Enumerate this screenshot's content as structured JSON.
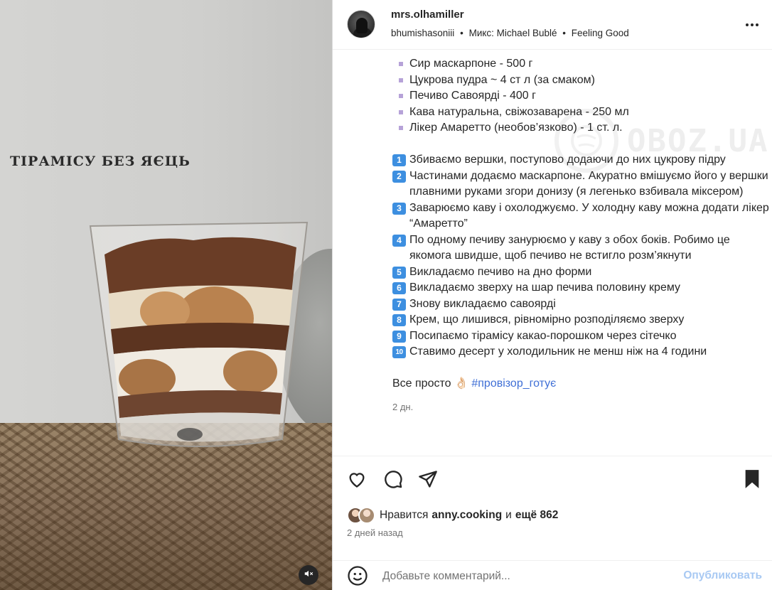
{
  "media": {
    "overlay_title": "ТІРАМІСУ БЕЗ ЯЄЦЬ",
    "mute_icon": "speaker-muted-icon"
  },
  "header": {
    "username": "mrs.olhamiller",
    "audio_author": "bhumishasoniii",
    "separator": "•",
    "audio_label": "Микс: Michael Bublé",
    "audio_track": "Feeling Good",
    "more_icon": "more-options-icon"
  },
  "caption": {
    "ingredients": [
      "Сир маскарпоне - 500 г",
      "Цукрова пудра ~ 4 ст л (за смаком)",
      "Печиво Савоярді - 400 г",
      "Кава натуральна, свіжозаварена - 250 мл",
      "Лікер Амаретто (необов’язково) - 1 ст. л."
    ],
    "steps": [
      {
        "n": "1",
        "text": "Збиваємо вершки, поступово додаючи до них цукрову підру"
      },
      {
        "n": "2",
        "text": "Частинами додаємо маскарпоне. Акуратно вмішуємо його у вершки плавними руками згори донизу (я легенько взбивала міксером)"
      },
      {
        "n": "3",
        "text": "Заварюємо каву і охолоджуємо. У холодну каву можна додати лікер “Амаретто”"
      },
      {
        "n": "4",
        "text": "По одному печиву занурюємо у каву з обох боків. Робимо це якомога швидше, щоб печиво не встигло розм’якнути"
      },
      {
        "n": "5",
        "text": "Викладаємо печиво на дно форми"
      },
      {
        "n": "6",
        "text": "Викладаємо зверху на шар печива половину крему"
      },
      {
        "n": "7",
        "text": "Знову викладаємо савоярді"
      },
      {
        "n": "8",
        "text": "Крем, що лишився, рівномірно розподіляємо зверху"
      },
      {
        "n": "9",
        "text": "Посипаємо тірамісу какао-порошком через сітечко"
      },
      {
        "n": "10",
        "text": "Ставимо десерт у холодильник не менш ніж на 4 години"
      }
    ],
    "final_text": "Все просто",
    "final_emoji": "👌🏻",
    "hashtag": "#провізор_готує",
    "time_ago": "2 дн."
  },
  "actions": {
    "like_icon": "heart-icon",
    "comment_icon": "comment-icon",
    "share_icon": "share-icon",
    "save_icon": "bookmark-icon",
    "likes_prefix": "Нравится",
    "likes_user": "anny.cooking",
    "likes_mid": "и",
    "likes_count": "ещё 862",
    "date": "2 дней назад"
  },
  "comment": {
    "emoji_icon": "smiley-icon",
    "placeholder": "Добавьте комментарий...",
    "post_label": "Опубликовать"
  },
  "watermark": {
    "text": "OBOZ.UA"
  },
  "colors": {
    "step_badge": "#3d8fe0",
    "bullet": "#b6a2d8",
    "hashtag": "#3f6fd6",
    "post_button": "#a8c9f3",
    "muted_text": "#737373"
  }
}
